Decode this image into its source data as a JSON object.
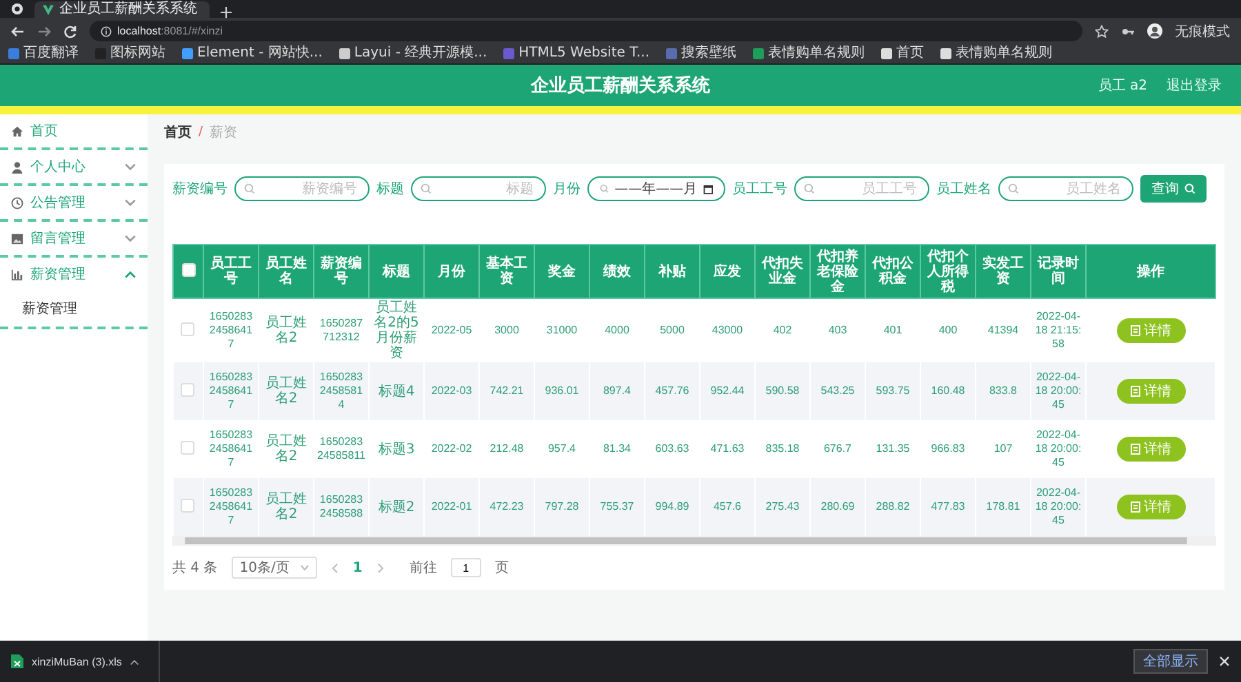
{
  "browser": {
    "tab_title": "企业员工薪酬关系系统",
    "url_host": "localhost",
    "url_rest": ":8081/#/xinzi",
    "profile_label": "无痕模式",
    "bookmarks": [
      {
        "label": "百度翻译",
        "color": "#3b7ddd"
      },
      {
        "label": "图标网站",
        "color": "#222222"
      },
      {
        "label": "Element - 网站快...",
        "color": "#409eff"
      },
      {
        "label": "Layui - 经典开源模...",
        "color": "#cccccc"
      },
      {
        "label": "HTML5 Website T...",
        "color": "#6a5acd"
      },
      {
        "label": "搜索壁纸",
        "color": "#5b6bb0"
      },
      {
        "label": "表情购单名规则",
        "color": "#1e9e5a"
      },
      {
        "label": "首页",
        "color": "#dddddd"
      },
      {
        "label": "表情购单名规则",
        "color": "#dddddd"
      }
    ]
  },
  "header": {
    "title": "企业员工薪酬关系系统",
    "user": "员工 a2",
    "logout": "退出登录"
  },
  "sidebar": {
    "items": [
      {
        "label": "首页"
      },
      {
        "label": "个人中心",
        "expanded": false
      },
      {
        "label": "公告管理",
        "expanded": false
      },
      {
        "label": "留言管理",
        "expanded": false
      },
      {
        "label": "薪资管理",
        "expanded": true,
        "children": [
          {
            "label": "薪资管理",
            "selected": true
          }
        ]
      }
    ]
  },
  "breadcrumb": [
    "首页",
    "薪资"
  ],
  "breadcrumb_separator": "/",
  "filters": [
    {
      "label": "薪资编号",
      "kind": "text",
      "placeholder": "薪资编号"
    },
    {
      "label": "标题",
      "kind": "text",
      "placeholder": "标题"
    },
    {
      "label": "月份",
      "kind": "month",
      "placeholder": "——年——月"
    },
    {
      "label": "员工工号",
      "kind": "text",
      "placeholder": "员工工号"
    },
    {
      "label": "员工姓名",
      "kind": "text",
      "placeholder": "员工姓名"
    }
  ],
  "search_button": "查询",
  "table": {
    "select_all": {
      "checked": false
    },
    "columns": [
      "员工工号",
      "员工姓名",
      "薪资编号",
      "标题",
      "月份",
      "基本工资",
      "奖金",
      "绩效",
      "补贴",
      "应发",
      "代扣失业金",
      "代扣养老保险金",
      "代扣公积金",
      "代扣个人所得税",
      "实发工资",
      "记录时间",
      "操作"
    ],
    "rows": [
      {
        "selected": false,
        "cells": [
          "165028324586417",
          "员工姓名2",
          "1650287712312",
          "员工姓名2的5月份薪资",
          "2022-05",
          "3000",
          "31000",
          "4000",
          "5000",
          "43000",
          "402",
          "403",
          "401",
          "400",
          "41394",
          "2022-04-18 21:15:58"
        ],
        "action": "详情"
      },
      {
        "selected": false,
        "cells": [
          "165028324586417",
          "员工姓名2",
          "165028324585814",
          "标题4",
          "2022-03",
          "742.21",
          "936.01",
          "897.4",
          "457.76",
          "952.44",
          "590.58",
          "543.25",
          "593.75",
          "160.48",
          "833.8",
          "2022-04-18 20:00:45"
        ],
        "action": "详情"
      },
      {
        "selected": false,
        "cells": [
          "165028324586417",
          "员工姓名2",
          "165028324585811",
          "标题3",
          "2022-02",
          "212.48",
          "957.4",
          "81.34",
          "603.63",
          "471.63",
          "835.18",
          "676.7",
          "131.35",
          "966.83",
          "107",
          "2022-04-18 20:00:45"
        ],
        "action": "详情"
      },
      {
        "selected": false,
        "cells": [
          "165028324586417",
          "员工姓名2",
          "16502832458588",
          "标题2",
          "2022-01",
          "472.23",
          "797.28",
          "755.37",
          "994.89",
          "457.6",
          "275.43",
          "280.69",
          "288.82",
          "477.83",
          "178.81",
          "2022-04-18 20:00:45"
        ],
        "action": "详情"
      }
    ]
  },
  "pagination": {
    "total": "共 4 条",
    "page_size": "10条/页",
    "pages": [
      {
        "label": "1",
        "selected": true
      }
    ],
    "goto_label": "前往",
    "goto_value": "1",
    "goto_suffix": "页"
  },
  "downloads": {
    "file": "xinziMuBan (3).xls",
    "show_all": "全部显示"
  }
}
